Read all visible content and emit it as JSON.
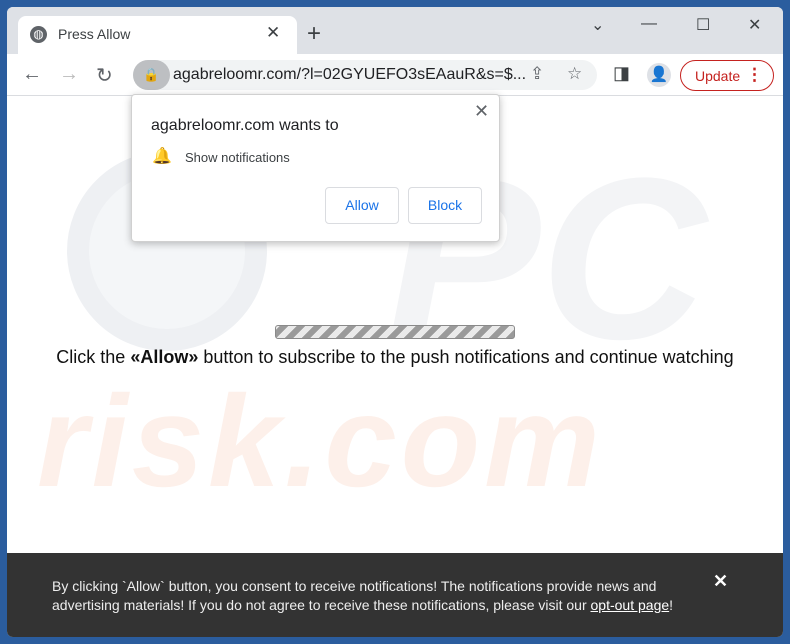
{
  "browser": {
    "tab_title": "Press Allow",
    "url": "agabreloomr.com/?l=02GYUEFO3sEAauR&s=$...",
    "update_label": "Update"
  },
  "popup": {
    "title": "agabreloomr.com wants to",
    "permission": "Show notifications",
    "allow": "Allow",
    "block": "Block"
  },
  "page": {
    "message_pre": "Click the ",
    "message_bold": "«Allow»",
    "message_post": " button to subscribe to the push notifications and continue watching",
    "progress_state": "indeterminate",
    "watermark": "risk.com"
  },
  "banner": {
    "text": "By clicking `Allow` button, you consent to receive notifications! The notifications provide news and advertising materials! If you do not agree to receive these notifications, please visit our ",
    "link": "opt-out page",
    "end": "!"
  },
  "colors": {
    "frame": "#2b5d9e",
    "update": "#c5221f",
    "link_button": "#1a73e8",
    "banner_bg": "#333333"
  }
}
